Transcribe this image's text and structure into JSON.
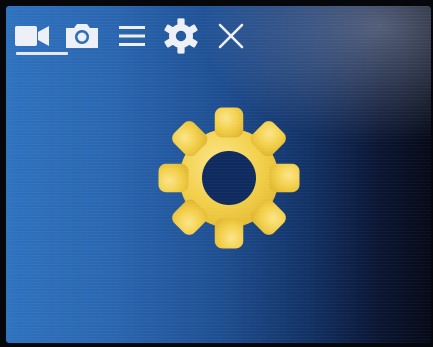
{
  "toolbar": {
    "tabs": [
      {
        "name": "video",
        "icon": "video-camera-icon",
        "selected": true
      },
      {
        "name": "photo",
        "icon": "camera-icon",
        "selected": false
      },
      {
        "name": "menu",
        "icon": "menu-icon",
        "selected": false
      },
      {
        "name": "settings",
        "icon": "gear-icon",
        "selected": false
      },
      {
        "name": "close",
        "icon": "close-icon",
        "selected": false
      }
    ]
  },
  "main": {
    "icon": "gear-icon"
  },
  "colors": {
    "icon_white": "#eef0f8",
    "gear_yellow": "#f4d24c",
    "screen_blue": "#2a66b0",
    "screen_dark": "#050a18"
  }
}
